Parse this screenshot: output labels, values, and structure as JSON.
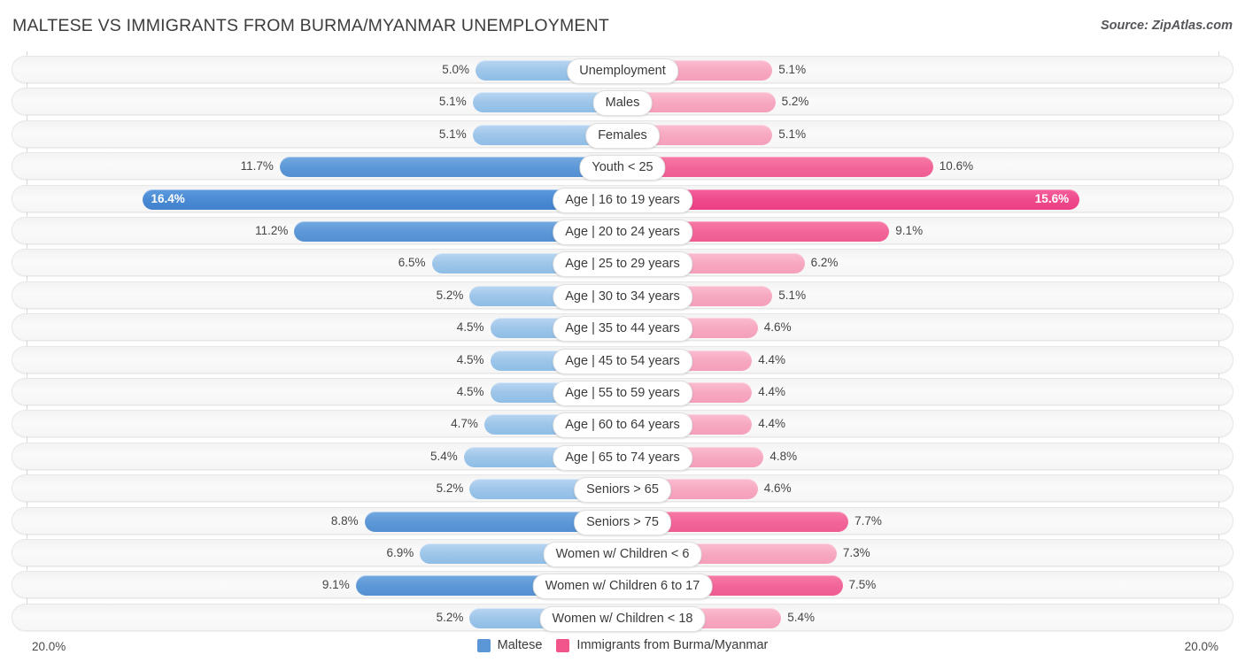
{
  "header": {
    "title": "MALTESE VS IMMIGRANTS FROM BURMA/MYANMAR UNEMPLOYMENT",
    "source": "Source: ZipAtlas.com"
  },
  "axis": {
    "left_max_label": "20.0%",
    "right_max_label": "20.0%",
    "max_value": 20.0
  },
  "legend": {
    "items": [
      {
        "label": "Maltese",
        "color": "#5b96d6"
      },
      {
        "label": "Immigrants from Burma/Myanmar",
        "color": "#f2558c"
      }
    ]
  },
  "chart_data": {
    "type": "bar",
    "orientation": "horizontal-diverging",
    "title": "MALTESE VS IMMIGRANTS FROM BURMA/MYANMAR UNEMPLOYMENT",
    "xlabel": "",
    "ylabel": "",
    "xlim": [
      0,
      20.0
    ],
    "grid": true,
    "legend_position": "bottom-center",
    "categories": [
      "Unemployment",
      "Males",
      "Females",
      "Youth < 25",
      "Age | 16 to 19 years",
      "Age | 20 to 24 years",
      "Age | 25 to 29 years",
      "Age | 30 to 34 years",
      "Age | 35 to 44 years",
      "Age | 45 to 54 years",
      "Age | 55 to 59 years",
      "Age | 60 to 64 years",
      "Age | 65 to 74 years",
      "Seniors > 65",
      "Seniors > 75",
      "Women w/ Children < 6",
      "Women w/ Children 6 to 17",
      "Women w/ Children < 18"
    ],
    "series": [
      {
        "name": "Maltese",
        "color": "#5b96d6",
        "values": [
          5.0,
          5.1,
          5.1,
          11.7,
          16.4,
          11.2,
          6.5,
          5.2,
          4.5,
          4.5,
          4.5,
          4.7,
          5.4,
          5.2,
          8.8,
          6.9,
          9.1,
          5.2
        ]
      },
      {
        "name": "Immigrants from Burma/Myanmar",
        "color": "#f2558c",
        "values": [
          5.1,
          5.2,
          5.1,
          10.6,
          15.6,
          9.1,
          6.2,
          5.1,
          4.6,
          4.4,
          4.4,
          4.4,
          4.8,
          4.6,
          7.7,
          7.3,
          7.5,
          5.4
        ]
      }
    ]
  },
  "rows": [
    {
      "label": "Unemployment",
      "left": "5.0%",
      "right": "5.1%",
      "lv": 5.0,
      "rv": 5.1
    },
    {
      "label": "Males",
      "left": "5.1%",
      "right": "5.2%",
      "lv": 5.1,
      "rv": 5.2
    },
    {
      "label": "Females",
      "left": "5.1%",
      "right": "5.1%",
      "lv": 5.1,
      "rv": 5.1
    },
    {
      "label": "Youth < 25",
      "left": "11.7%",
      "right": "10.6%",
      "lv": 11.7,
      "rv": 10.6
    },
    {
      "label": "Age | 16 to 19 years",
      "left": "16.4%",
      "right": "15.6%",
      "lv": 16.4,
      "rv": 15.6
    },
    {
      "label": "Age | 20 to 24 years",
      "left": "11.2%",
      "right": "9.1%",
      "lv": 11.2,
      "rv": 9.1
    },
    {
      "label": "Age | 25 to 29 years",
      "left": "6.5%",
      "right": "6.2%",
      "lv": 6.5,
      "rv": 6.2
    },
    {
      "label": "Age | 30 to 34 years",
      "left": "5.2%",
      "right": "5.1%",
      "lv": 5.2,
      "rv": 5.1
    },
    {
      "label": "Age | 35 to 44 years",
      "left": "4.5%",
      "right": "4.6%",
      "lv": 4.5,
      "rv": 4.6
    },
    {
      "label": "Age | 45 to 54 years",
      "left": "4.5%",
      "right": "4.4%",
      "lv": 4.5,
      "rv": 4.4
    },
    {
      "label": "Age | 55 to 59 years",
      "left": "4.5%",
      "right": "4.4%",
      "lv": 4.5,
      "rv": 4.4
    },
    {
      "label": "Age | 60 to 64 years",
      "left": "4.7%",
      "right": "4.4%",
      "lv": 4.7,
      "rv": 4.4
    },
    {
      "label": "Age | 65 to 74 years",
      "left": "5.4%",
      "right": "4.8%",
      "lv": 5.4,
      "rv": 4.8
    },
    {
      "label": "Seniors > 65",
      "left": "5.2%",
      "right": "4.6%",
      "lv": 5.2,
      "rv": 4.6
    },
    {
      "label": "Seniors > 75",
      "left": "8.8%",
      "right": "7.7%",
      "lv": 8.8,
      "rv": 7.7
    },
    {
      "label": "Women w/ Children < 6",
      "left": "6.9%",
      "right": "7.3%",
      "lv": 6.9,
      "rv": 7.3
    },
    {
      "label": "Women w/ Children 6 to 17",
      "left": "9.1%",
      "right": "7.5%",
      "lv": 9.1,
      "rv": 7.5
    },
    {
      "label": "Women w/ Children < 18",
      "left": "5.2%",
      "right": "5.4%",
      "lv": 5.2,
      "rv": 5.4
    }
  ]
}
